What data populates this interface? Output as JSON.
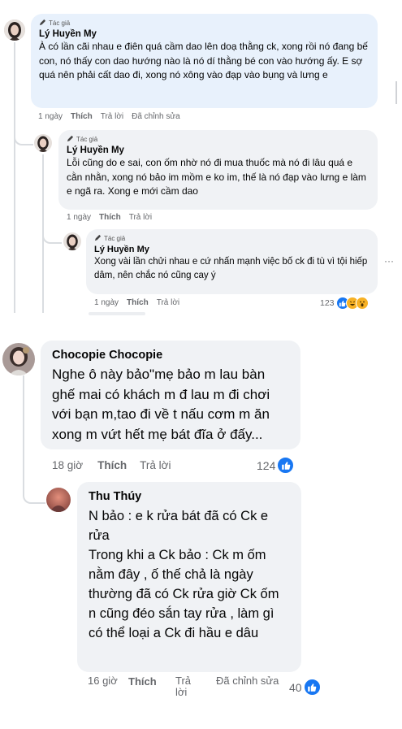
{
  "thread1": {
    "comments": [
      {
        "badge": "Tác giả",
        "author": "Lý Huyền My",
        "text": "À có lần cãi nhau e điên quá cầm dao lên doạ thằng ck, xong rồi nó đang bế con, nó thấy con dao hướng nào là nó dí thằng bé con vào hướng ấy. E sợ quá nên phải cất dao đi, xong nó xông vào đạp vào bụng và lưng e",
        "time": "1 ngày",
        "like": "Thích",
        "reply": "Trả lời",
        "edited": "Đã chỉnh sửa"
      },
      {
        "badge": "Tác giả",
        "author": "Lý Huyền My",
        "text": "Lỗi cũng do e sai, con ốm nhờ nó đi mua thuốc mà nó đi lâu quá e cằn nhằn, xong nó bảo im mồm e ko im, thế là nó đạp vào lưng e làm e ngã ra. Xong e mới cầm dao",
        "time": "1 ngày",
        "like": "Thích",
        "reply": "Trả lời"
      },
      {
        "badge": "Tác giả",
        "author": "Lý Huyền My",
        "text": "Xong vài lần chửi nhau e cứ nhấn mạnh việc bố ck đi tù vì tội hiếp dâm, nên chắc nó cũng cay ý",
        "time": "1 ngày",
        "like": "Thích",
        "reply": "Trả lời",
        "reaction_count": "123"
      }
    ],
    "more": "···"
  },
  "thread2": {
    "comment": {
      "author": "Chocopie Chocopie",
      "text": "Nghe ô này bảo\"mẹ bảo m lau bàn ghế mai có khách m đ lau m đi chơi với bạn m,tao đi về t nấu cơm m ăn xong m vứt hết mẹ bát đĩa ở đấy...",
      "time": "18 giờ",
      "like": "Thích",
      "reply": "Trả lời",
      "reaction_count": "124"
    },
    "reply": {
      "author": "Thu Thúy",
      "text1": "N bảo : e k rửa bát đã có Ck e rửa",
      "text2": "Trong khi a Ck bảo : Ck m ốm nằm đây , ố thế chả là ngày thường đã có Ck rửa giờ Ck ốm n cũng đéo sắn tay rửa , làm gì có thể loại a Ck đi hầu e dâu",
      "time": "16 giờ",
      "like": "Thích",
      "reply": "Trả lời",
      "edited": "Đã chỉnh sửa",
      "reaction_count": "40"
    }
  },
  "colors": {
    "like": "#1877f2",
    "author_bubble": "#e8f1fc",
    "comment_bubble": "#f0f2f5",
    "meta": "#65676b"
  }
}
